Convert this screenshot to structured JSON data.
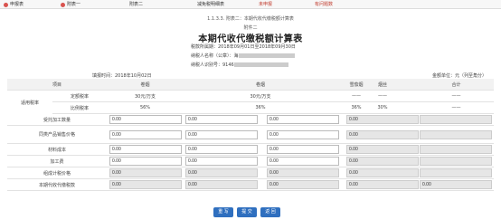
{
  "tabs": [
    {
      "label": "申报表"
    },
    {
      "label": "附表一"
    },
    {
      "label": "附表二"
    },
    {
      "label": "减免税明细表"
    },
    {
      "label": "未申报"
    },
    {
      "label": "有问题数"
    }
  ],
  "breadcrumb": "1.1.3.3. 附表二：本期代收代缴税额计算表",
  "attachment": "附件二",
  "title": "本期代收代缴税额计算表",
  "period": "税款所属期：2018年09月01日至2018年09月30日",
  "taxpayer_name": "纳税人名称（公章）：海",
  "taxpayer_id": "纳税人识别号：9146",
  "fill_date": "填报时间：2018年10月02日",
  "amount_unit": "金额单位：元（列至角分）",
  "header": {
    "item": "项目",
    "col1": "卷烟",
    "col2": "卷烟",
    "col3": "雪茄烟",
    "col4": "烟丝",
    "col5": "合计"
  },
  "rate_group": "适用税率",
  "rate_rows": [
    {
      "label": "定额税率",
      "c1": "30元/万支",
      "c2": "30元/万支",
      "c3": "——",
      "c4": "——",
      "c5": "——"
    },
    {
      "label": "比例税率",
      "c1": "56%",
      "c2": "36%",
      "c3": "36%",
      "c4": "30%",
      "c5": "——"
    }
  ],
  "data_rows": [
    {
      "label": "受托加工数量",
      "c1": "0.00",
      "c2": "0.00",
      "c3": "0.00",
      "c4": "0.00",
      "c5": ""
    },
    {
      "label": "同类产品销售价格",
      "c1": "0.00",
      "c2": "0.00",
      "c3": "0.00",
      "c4": "0.00",
      "c5": ""
    },
    {
      "label": "材料成本",
      "c1": "0.00",
      "c2": "0.00",
      "c3": "0.00",
      "c4": "0.00",
      "c5": ""
    },
    {
      "label": "加工费",
      "c1": "0.00",
      "c2": "0.00",
      "c3": "0.00",
      "c4": "0.00",
      "c5": ""
    },
    {
      "label": "组成计税价格",
      "c1": "0.00",
      "c2": "0.00",
      "c3": "0.00",
      "c4": "0.00",
      "c5": ""
    },
    {
      "label": "本期代收代缴税款",
      "c1": "0.00",
      "c2": "0.00",
      "c3": "0.00",
      "c4": "0.00",
      "c5": "0.00"
    }
  ],
  "buttons": {
    "reset": "重 写",
    "submit": "提 交",
    "back": "返 回"
  }
}
